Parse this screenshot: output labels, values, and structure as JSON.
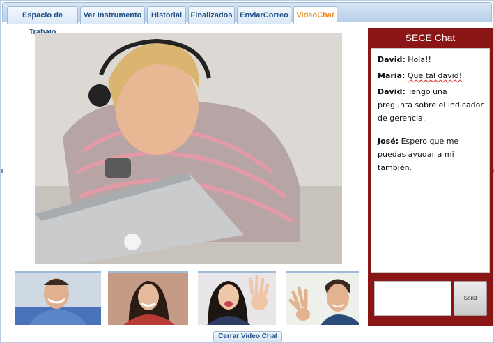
{
  "tabs": [
    {
      "label": "Espacio de Trabajo",
      "active": false
    },
    {
      "label": "Ver Instrumento",
      "active": false
    },
    {
      "label": "Historial",
      "active": false
    },
    {
      "label": "Finalizados",
      "active": false
    },
    {
      "label": "EnviarCorreo",
      "active": false
    },
    {
      "label": "VideoChat",
      "active": true
    }
  ],
  "videochat": {
    "close_label": "Cerrar Video Chat"
  },
  "chat": {
    "title": "SECE Chat",
    "messages": [
      {
        "author": "David:",
        "text": "Hola!!"
      },
      {
        "author": "Maria:",
        "text": "Que tal david!"
      },
      {
        "author": "David:",
        "text": "Tengo una pregunta sobre el indicador de gerencia."
      },
      {
        "author": "José:",
        "text": "Espero que me puedas ayudar a mi también."
      }
    ],
    "input_value": "",
    "send_label": "Send"
  },
  "colors": {
    "tab_text": "#1f4f86",
    "tab_active_text": "#e8891c",
    "chat_panel": "#8a1515"
  }
}
